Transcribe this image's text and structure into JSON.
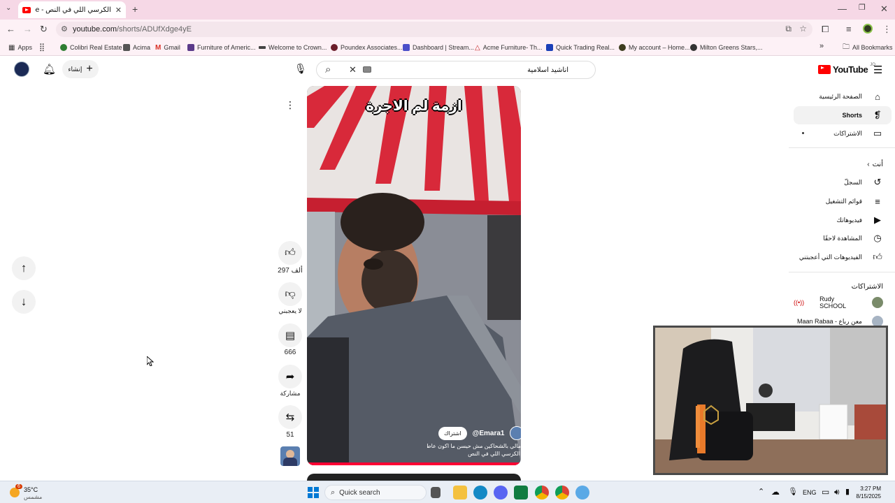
{
  "browser": {
    "tab_title": "الكرسي اللي في النص - YouTube",
    "url_host": "youtube.com",
    "url_path": "/shorts/ADUfXdge4yE",
    "bookmarks": [
      "Apps",
      "Colibri Real Estate",
      "Acima",
      "Gmail",
      "Furniture of Americ...",
      "Welcome to Crown...",
      "Poundex Associates...",
      "Dashboard | Stream...",
      "Acme Furniture- Th...",
      "Quick Trading Real...",
      "My account – Home...",
      "Milton Greens Stars,..."
    ],
    "all_bookmarks": "All Bookmarks"
  },
  "youtube": {
    "logo_text": "YouTube",
    "region_code": "JO",
    "search_value": "اناشيد اسلامية",
    "create_label": "إنشاء",
    "sidebar": {
      "home": "الصفحة الرئيسية",
      "shorts": "Shorts",
      "subscriptions": "الاشتراكات",
      "you_header": "أنت",
      "history": "السجلّ",
      "playlists": "قوائم التشغيل",
      "your_videos": "فيديوهاتك",
      "watch_later": "المشاهدة لاحقًا",
      "liked": "الفيديوهات التي أعجبتني",
      "subs_header": "الاشتراكات",
      "channels": [
        "Rudy SCHOOL",
        "معن رباع - Maan Rabaa"
      ]
    },
    "short": {
      "overlay_text": "ازمة لم الاجرة",
      "channel": "@Emara1",
      "subscribe": "اشتراك",
      "description_line1": "مالي بالشحاكين مش حيسن ما اكون عاطل",
      "description_line2": "الكرسي اللي في النص",
      "likes": "297 ألف",
      "dislike_label": "لا يعجبني",
      "comments": "666",
      "share_label": "مشاركة",
      "remix_count": "51"
    }
  },
  "taskbar": {
    "weather_temp": "35°C",
    "weather_desc": "مشمس",
    "weather_badge": "6",
    "search_placeholder": "Quick search",
    "language": "ENG",
    "time": "3:27 PM",
    "date": "8/15/2025"
  },
  "colors": {
    "tabstrip": "#f6d8e6",
    "toolbar": "#fdf1f6",
    "youtube_red": "#ff0000",
    "taskbar": "#e9eef5"
  }
}
